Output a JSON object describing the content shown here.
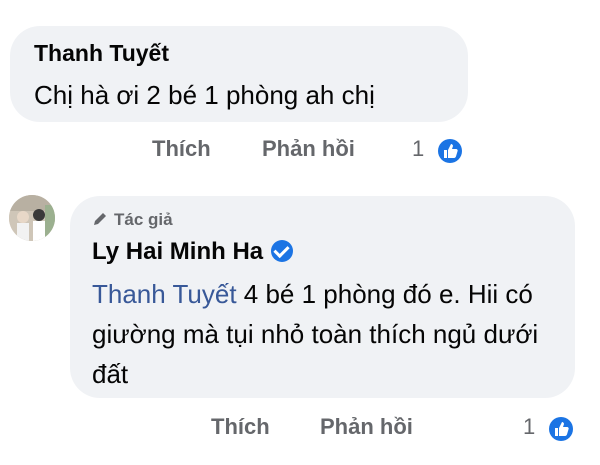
{
  "comments": [
    {
      "author": "Thanh Tuyết",
      "text": "Chị hà ơi 2 bé 1 phòng ah chị",
      "actions": {
        "like_label": "Thích",
        "reply_label": "Phản hồi",
        "like_count": "1"
      }
    },
    {
      "badge": "Tác giả",
      "author": "Ly Hai Minh Ha",
      "mention": "Thanh Tuyết",
      "text": " 4 bé 1 phòng đó e. Hii có giường mà tụi nhỏ toàn thích ngủ dưới đất",
      "verified": true,
      "actions": {
        "like_label": "Thích",
        "reply_label": "Phản hồi",
        "like_count": "1"
      }
    }
  ],
  "colors": {
    "accent": "#1b74e4",
    "mention": "#385898",
    "bubble": "#f0f2f5",
    "muted": "#65676b"
  },
  "icons": {
    "like": "thumbs-up-icon",
    "author_badge": "pencil-icon",
    "verified": "verified-check-icon"
  }
}
